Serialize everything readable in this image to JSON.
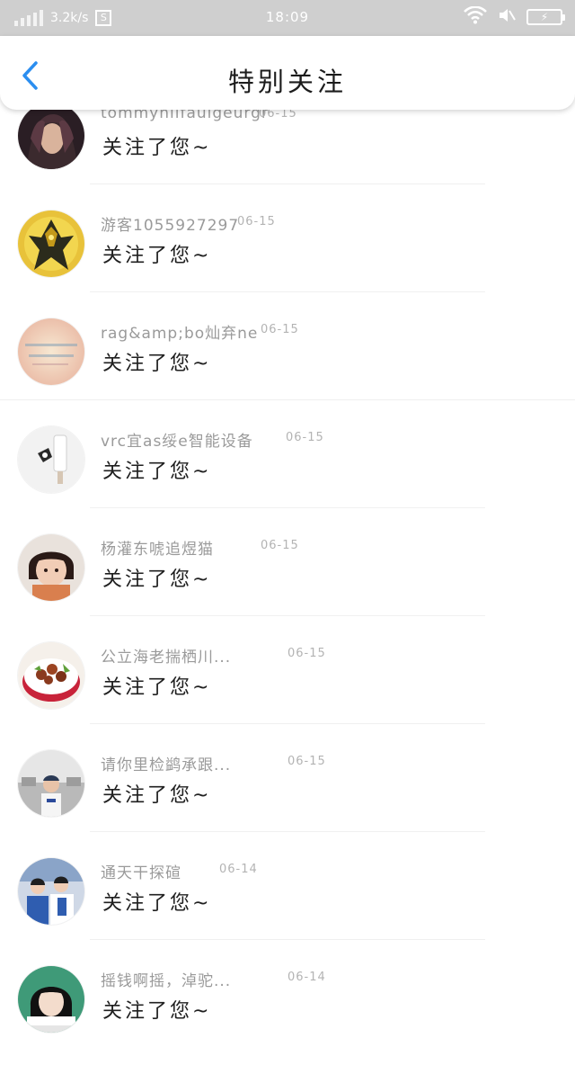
{
  "status_bar": {
    "network_speed": "3.2k/s",
    "sim_label": "S",
    "time": "18:09",
    "wifi_icon": "wifi-icon",
    "mute_icon": "mute-icon",
    "battery_icon": "battery-charging-icon",
    "battery_glyph": "⚡"
  },
  "header": {
    "back_icon": "chevron-left-icon",
    "title": "特别关注",
    "accent_color": "#2b8ef0"
  },
  "list": {
    "items": [
      {
        "name": "tommyhilfauigeurgr",
        "date": "06-15",
        "message": "关注了您~"
      },
      {
        "name": "游客1055927297",
        "date": "06-15",
        "message": "关注了您~"
      },
      {
        "name": "rag&amp;bo灿弃ne",
        "date": "06-15",
        "message": "关注了您~"
      },
      {
        "name": "vrc宜as绥e智能设备",
        "date": "06-15",
        "message": "关注了您~"
      },
      {
        "name": "杨灌东唬追煜猫",
        "date": "06-15",
        "message": "关注了您~"
      },
      {
        "name": "公立海老揣栖川...",
        "date": "06-15",
        "message": "关注了您~"
      },
      {
        "name": "请你里检鹢承跟...",
        "date": "06-15",
        "message": "关注了您~"
      },
      {
        "name": "通天干探碹",
        "date": "06-14",
        "message": "关注了您~"
      },
      {
        "name": "摇钱啊摇，淖驼...",
        "date": "06-14",
        "message": "关注了您~"
      }
    ]
  }
}
